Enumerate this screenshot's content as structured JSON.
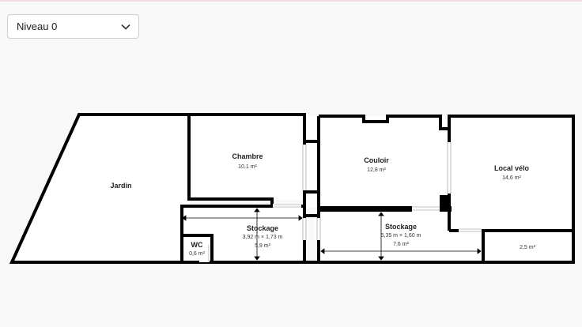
{
  "level_selector": {
    "value": "Niveau 0",
    "icon": "chevron-down-icon"
  },
  "rooms": {
    "jardin": {
      "name": "Jardin"
    },
    "chambre": {
      "name": "Chambre",
      "area": "10,1 m²"
    },
    "couloir": {
      "name": "Couloir",
      "area": "12,8 m²"
    },
    "local_velo": {
      "name": "Local vélo",
      "area": "14,6 m²"
    },
    "stockage_1": {
      "name": "Stockage",
      "dimensions": "3,92 m × 1,73 m",
      "area": "5,9 m²"
    },
    "wc": {
      "name": "WC",
      "area": "0,6 m²"
    },
    "stockage_2": {
      "name": "Stockage",
      "dimensions": "5,35 m × 1,60 m",
      "area": "7,6 m²"
    },
    "small_room": {
      "area": "2,5 m²"
    }
  },
  "colors": {
    "wall": "#000000",
    "background": "#f9f8f8",
    "floor": "#ffffff"
  }
}
